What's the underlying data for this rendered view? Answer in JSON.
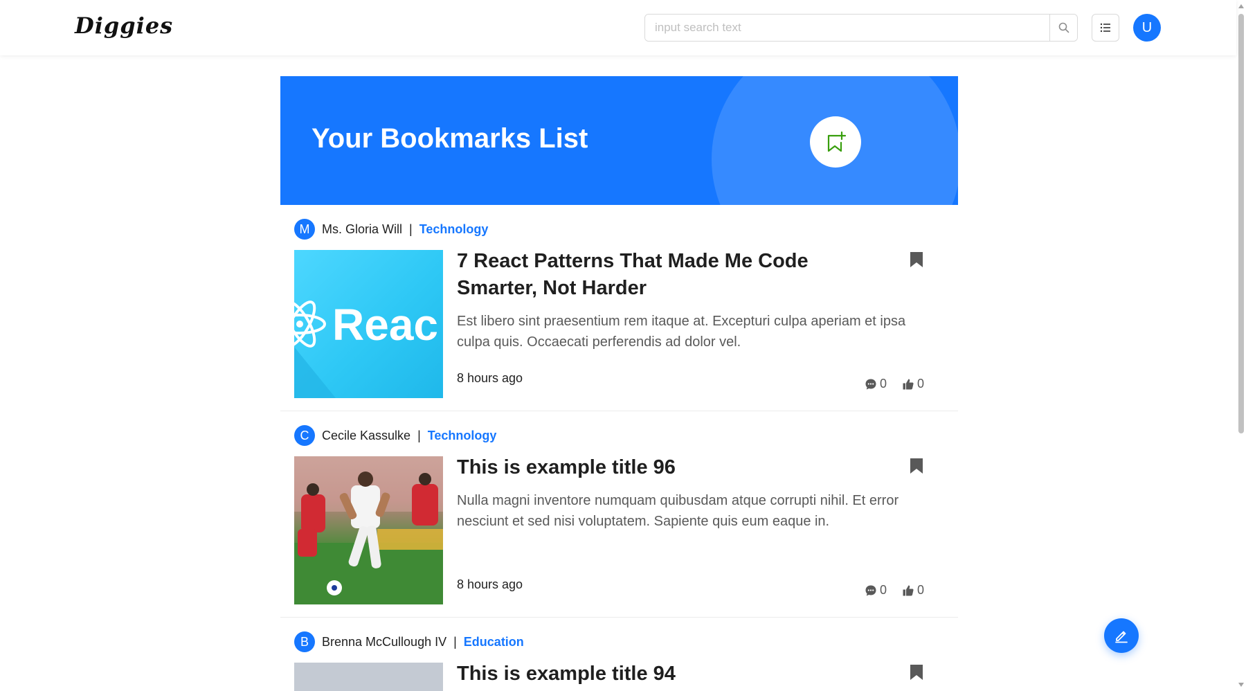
{
  "header": {
    "logo": "Diggies",
    "search_placeholder": "input search text",
    "user_initial": "U"
  },
  "banner": {
    "title": "Your Bookmarks List"
  },
  "posts": [
    {
      "author_initial": "M",
      "author": "Ms. Gloria Will",
      "separator": "|",
      "category": "Technology",
      "title": "7 React Patterns That Made Me Code Smarter, Not Harder",
      "excerpt": "Est libero sint praesentium rem itaque at. Excepturi culpa aperiam et ipsa culpa quis. Occaecati perferendis ad dolor vel.",
      "time": "8 hours ago",
      "comments": "0",
      "likes": "0",
      "thumb_text": "Reac"
    },
    {
      "author_initial": "C",
      "author": "Cecile Kassulke",
      "separator": "|",
      "category": "Technology",
      "title": "This is example title 96",
      "excerpt": "Nulla magni inventore numquam quibusdam atque corrupti nihil. Et error nesciunt et sed nisi voluptatem. Sapiente quis eum eaque in.",
      "time": "8 hours ago",
      "comments": "0",
      "likes": "0"
    },
    {
      "author_initial": "B",
      "author": "Brenna McCullough IV",
      "separator": "|",
      "category": "Education",
      "title": "This is example title 94"
    }
  ],
  "colors": {
    "primary": "#1677ff",
    "banner_icon": "#389e0d"
  }
}
